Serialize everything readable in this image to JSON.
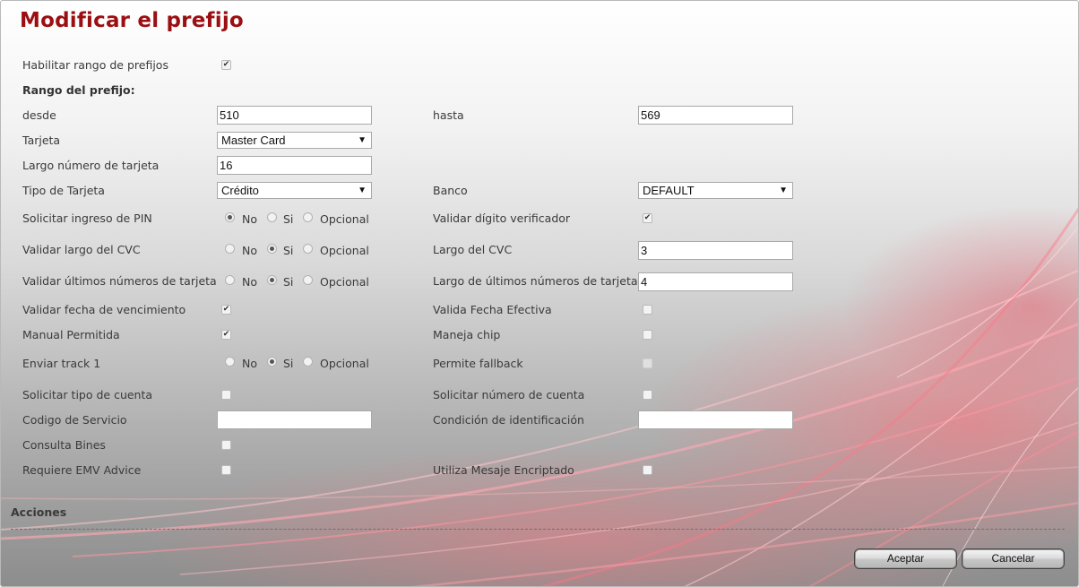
{
  "title": "Modificar el prefijo",
  "habilitar": {
    "label": "Habilitar rango de prefijos",
    "checked": true
  },
  "rango_title": "Rango del prefijo:",
  "desde": {
    "label": "desde",
    "value": "510"
  },
  "hasta": {
    "label": "hasta",
    "value": "569"
  },
  "tarjeta": {
    "label": "Tarjeta",
    "value": "Master Card"
  },
  "largo_numero": {
    "label": "Largo número de tarjeta",
    "value": "16"
  },
  "tipo_tarjeta": {
    "label": "Tipo de Tarjeta",
    "value": "Crédito"
  },
  "banco": {
    "label": "Banco",
    "value": "DEFAULT"
  },
  "radio_options": {
    "no": "No",
    "si": "Si",
    "opcional": "Opcional"
  },
  "solicitar_pin": {
    "label": "Solicitar ingreso de PIN",
    "selected": "No"
  },
  "validar_digito": {
    "label": "Validar dígito verificador",
    "checked": true
  },
  "validar_largo_cvc": {
    "label": "Validar largo del CVC",
    "selected": "Si"
  },
  "largo_cvc": {
    "label": "Largo del CVC",
    "value": "3"
  },
  "validar_ultimos": {
    "label": "Validar últimos números de tarjeta",
    "selected": "Si"
  },
  "largo_ultimos": {
    "label": "Largo de últimos números de tarjeta",
    "value": "4"
  },
  "validar_fecha_venc": {
    "label": "Validar fecha de vencimiento",
    "checked": true
  },
  "valida_fecha_efectiva": {
    "label": "Valida Fecha Efectiva",
    "checked": false
  },
  "manual_permitida": {
    "label": "Manual Permitida",
    "checked": true
  },
  "maneja_chip": {
    "label": "Maneja chip",
    "checked": false
  },
  "enviar_track1": {
    "label": "Enviar track 1",
    "selected": "Si"
  },
  "permite_fallback": {
    "label": "Permite fallback",
    "checked": false,
    "disabled": true
  },
  "solicitar_tipo_cuenta": {
    "label": "Solicitar tipo de cuenta",
    "checked": false
  },
  "solicitar_numero_cuenta": {
    "label": "Solicitar número de cuenta",
    "checked": false
  },
  "codigo_servicio": {
    "label": "Codigo de Servicio",
    "value": ""
  },
  "condicion_identificacion": {
    "label": "Condición de identificación",
    "value": ""
  },
  "consulta_bines": {
    "label": "Consulta Bines",
    "checked": false
  },
  "requiere_emv": {
    "label": "Requiere EMV Advice",
    "checked": false
  },
  "utiliza_mensaje": {
    "label": "Utiliza Mesaje Encriptado",
    "checked": false
  },
  "acciones": "Acciones",
  "buttons": {
    "aceptar": "Aceptar",
    "cancelar": "Cancelar"
  },
  "colors": {
    "title": "#9b0f12",
    "accent_glow": "#ff6e78"
  },
  "icons": {
    "dropdown": "triangle-down-icon",
    "check": "check-mark-icon"
  }
}
